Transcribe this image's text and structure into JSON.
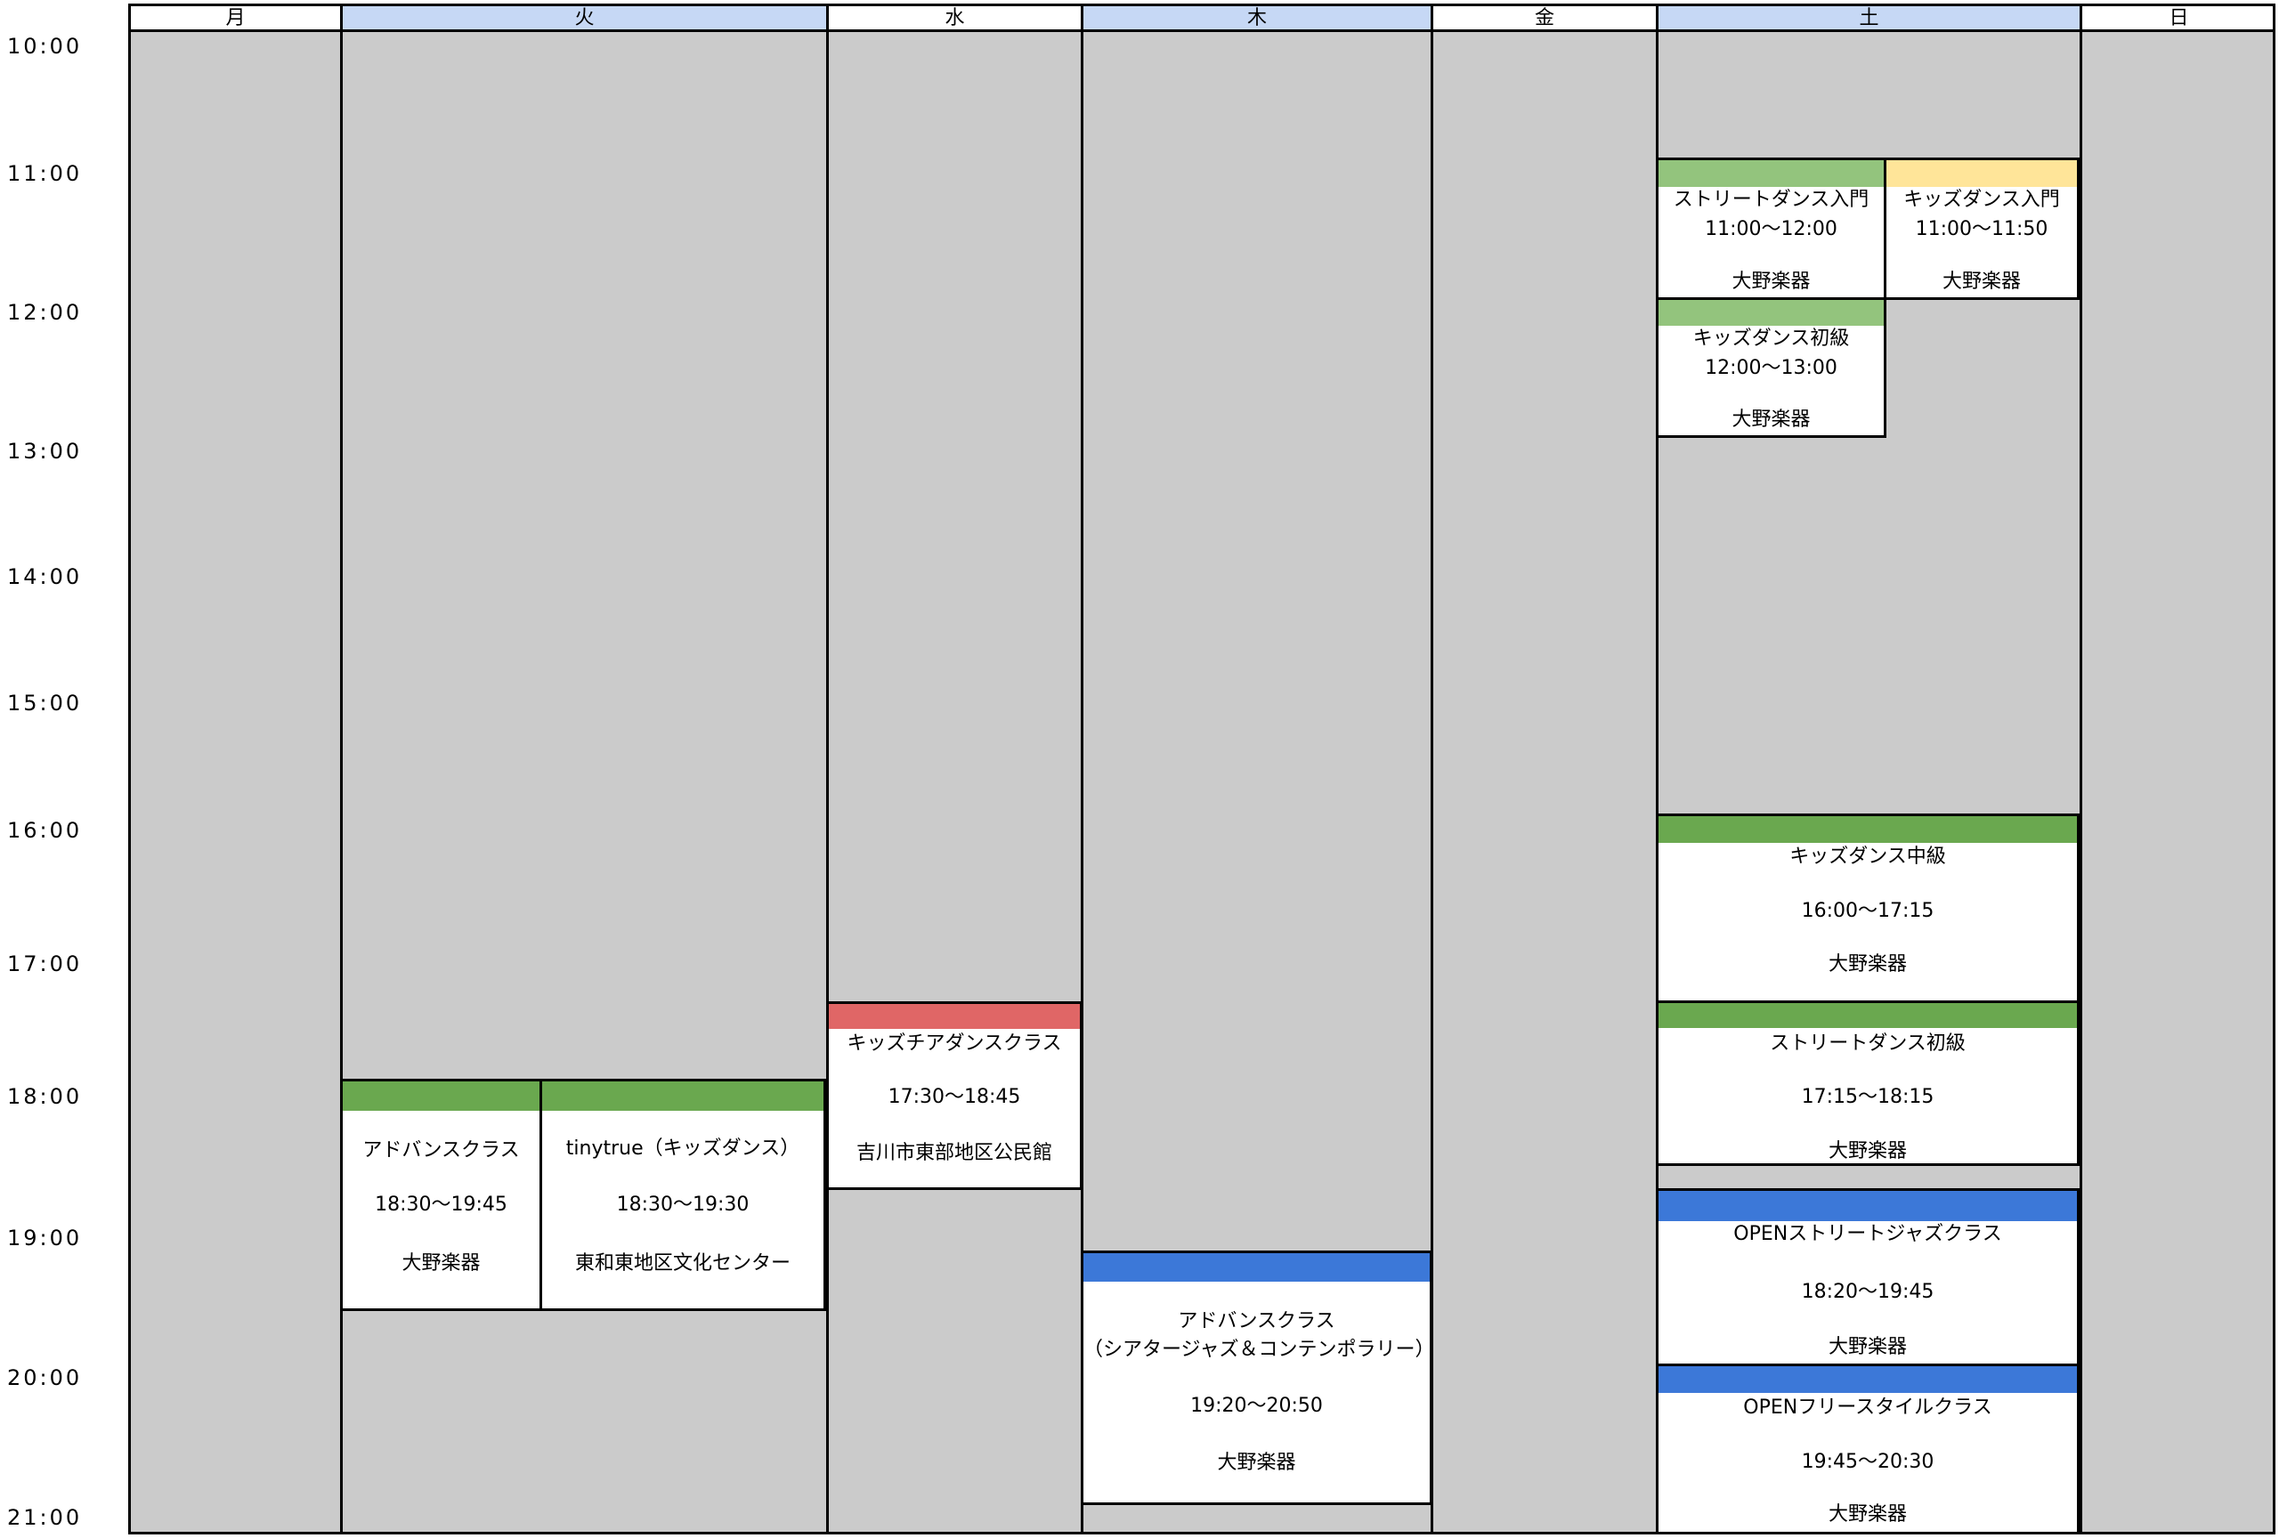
{
  "hours": [
    "10:00",
    "11:00",
    "12:00",
    "13:00",
    "14:00",
    "15:00",
    "16:00",
    "17:00",
    "18:00",
    "19:00",
    "20:00",
    "21:00"
  ],
  "days": [
    {
      "label": "月",
      "accent": false
    },
    {
      "label": "火",
      "accent": true
    },
    {
      "label": "水",
      "accent": false
    },
    {
      "label": "木",
      "accent": true
    },
    {
      "label": "金",
      "accent": false
    },
    {
      "label": "土",
      "accent": true
    },
    {
      "label": "日",
      "accent": false
    }
  ],
  "colors": {
    "grid_background": "#cbcbcb",
    "header_accent": "#c6d8f5",
    "green_light": "#93c47d",
    "green": "#6aa84f",
    "yellow": "#ffe599",
    "red": "#e06666",
    "blue": "#3c78d8"
  },
  "classes": {
    "tue_advance": {
      "title": "アドバンスクラス",
      "time": "18:30〜19:45",
      "place": "大野楽器",
      "color": "#6aa84f"
    },
    "tue_tinytrue": {
      "title": "tinytrue（キッズダンス）",
      "time": "18:30〜19:30",
      "place": "東和東地区文化センター",
      "color": "#6aa84f"
    },
    "wed_cheer": {
      "title": "キッズチアダンスクラス",
      "time": "17:30〜18:45",
      "place": "吉川市東部地区公民館",
      "color": "#e06666"
    },
    "thu_advance": {
      "title": "アドバンスクラス",
      "title2": "（シアタージャズ＆コンテンポラリー）",
      "time": "19:20〜20:50",
      "place": "大野楽器",
      "color": "#3c78d8"
    },
    "sat_street_intro": {
      "title": "ストリートダンス入門",
      "time": "11:00〜12:00",
      "place": "大野楽器",
      "color": "#93c47d"
    },
    "sat_kids_intro": {
      "title": "キッズダンス入門",
      "time": "11:00〜11:50",
      "place": "大野楽器",
      "color": "#ffe599"
    },
    "sat_kids_beginner": {
      "title": "キッズダンス初級",
      "time": "12:00〜13:00",
      "place": "大野楽器",
      "color": "#93c47d"
    },
    "sat_kids_intermediate": {
      "title": "キッズダンス中級",
      "time": "16:00〜17:15",
      "place": "大野楽器",
      "color": "#6aa84f"
    },
    "sat_street_beginner": {
      "title": "ストリートダンス初級",
      "time": "17:15〜18:15",
      "place": "大野楽器",
      "color": "#6aa84f"
    },
    "sat_open_jazz": {
      "title": "OPENストリートジャズクラス",
      "time": "18:20〜19:45",
      "place": "大野楽器",
      "color": "#3c78d8"
    },
    "sat_open_free": {
      "title": "OPENフリースタイルクラス",
      "time": "19:45〜20:30",
      "place": "大野楽器",
      "color": "#3c78d8"
    }
  }
}
